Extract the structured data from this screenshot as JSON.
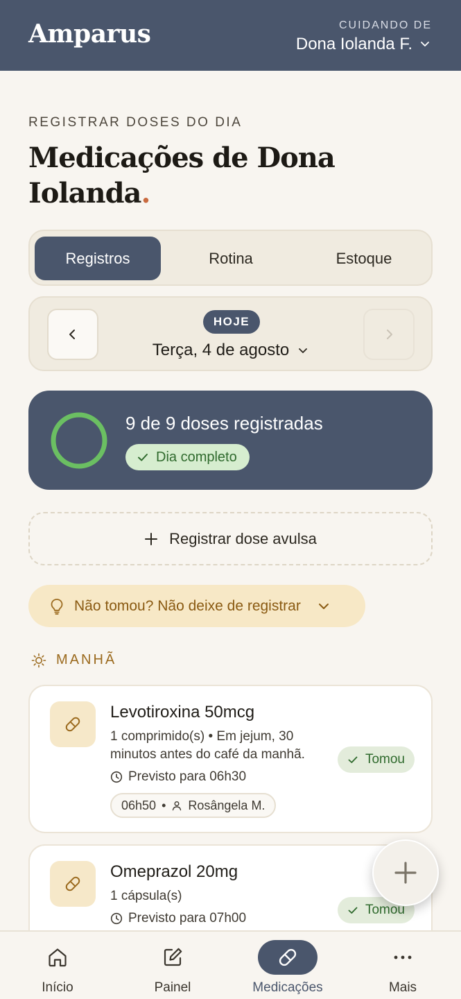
{
  "header": {
    "brand": "Amparus",
    "caring_label": "CUIDANDO DE",
    "caring_name": "Dona Iolanda F."
  },
  "page": {
    "eyebrow": "REGISTRAR DOSES DO DIA",
    "title": "Medicações de Dona Iolanda",
    "title_dot": "."
  },
  "tabs": [
    {
      "label": "Registros",
      "active": true
    },
    {
      "label": "Rotina",
      "active": false
    },
    {
      "label": "Estoque",
      "active": false
    }
  ],
  "date": {
    "badge": "HOJE",
    "label": "Terça, 4 de agosto"
  },
  "summary": {
    "title": "9 de 9 doses registradas",
    "status": "Dia completo",
    "progress": 1.0
  },
  "add_dose_label": "Registrar dose avulsa",
  "tip_label": "Não tomou? Não deixe de registrar",
  "section": {
    "label": "MANHÃ",
    "icon": "sun-icon"
  },
  "medications": [
    {
      "name": "Levotiroxina 50mcg",
      "description": "1 comprimido(s) • Em jejum, 30 minutos antes do café da manhã.",
      "scheduled": "Previsto para 06h30",
      "taken_time": "06h50",
      "taken_by": "Rosângela M.",
      "status": "Tomou"
    },
    {
      "name": "Omeprazol 20mg",
      "description": "1 cápsula(s)",
      "scheduled": "Previsto para 07h00",
      "status": "Tomou"
    }
  ],
  "bottom_nav": [
    {
      "label": "Início",
      "icon": "home-icon"
    },
    {
      "label": "Painel",
      "icon": "edit-icon"
    },
    {
      "label": "Medicações",
      "icon": "pill-icon",
      "active": true
    },
    {
      "label": "Mais",
      "icon": "more-icon"
    }
  ],
  "colors": {
    "primary": "#4a566c",
    "background": "#f8f5f0",
    "accent_dot": "#c96a3f",
    "success": "#6bbf62",
    "warning_bg": "#f7e8c6"
  }
}
